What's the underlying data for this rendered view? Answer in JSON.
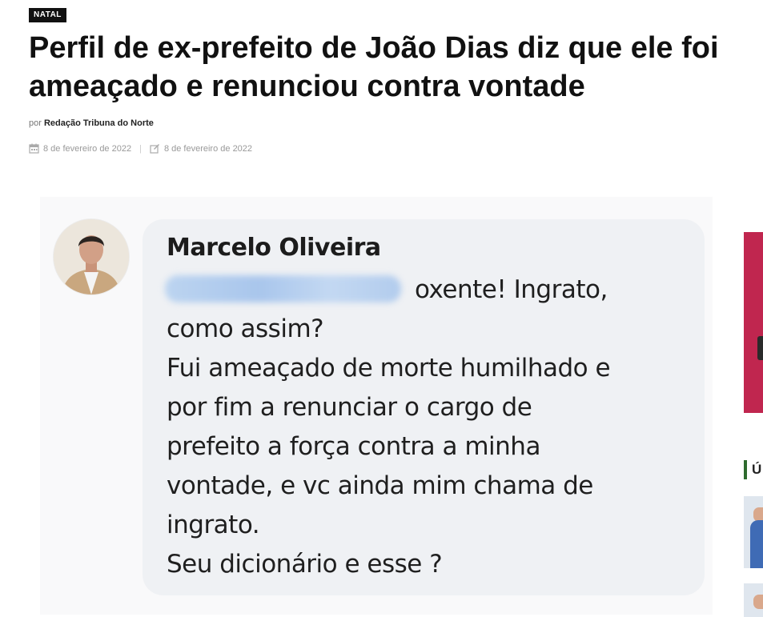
{
  "article": {
    "category": "NATAL",
    "title": "Perfil de ex-prefeito de João Dias diz que ele foi ameaçado e renunciou contra vontade",
    "byline_prefix": "por",
    "author": "Redação Tribuna do Norte",
    "published_date": "8 de fevereiro de 2022",
    "updated_date": "8 de fevereiro de 2022",
    "meta_separator": "|",
    "calendar_icon": "calendar-icon",
    "edit_icon": "edit-icon"
  },
  "image": {
    "commenter_name": "Marcelo Oliveira",
    "lines": [
      "oxente! Ingrato,",
      "como assim?",
      "Fui ameaçado de morte humilhado e",
      "por fim a renunciar o cargo de",
      "prefeito a força contra a minha",
      "vontade, e vc ainda mim chama de",
      "ingrato.",
      "Seu dicionário e esse ?"
    ]
  },
  "sidebar": {
    "heading_initial": "Ú"
  },
  "colors": {
    "tag_bg": "#111111",
    "sidebar_accent": "#c0264f",
    "sidebar_heading_bar": "#2e6b2e",
    "bubble_bg": "#eff1f4"
  }
}
